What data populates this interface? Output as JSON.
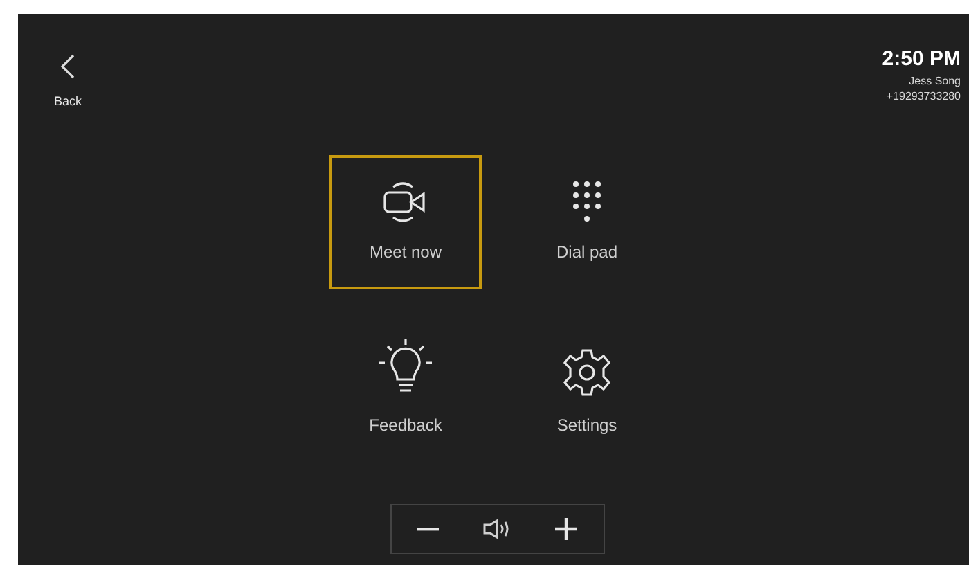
{
  "back": {
    "label": "Back"
  },
  "status": {
    "time": "2:50 PM",
    "name": "Jess Song",
    "phone": "+19293733280"
  },
  "tiles": [
    {
      "kind": "meet",
      "label": "Meet now",
      "selected": true
    },
    {
      "kind": "dialpad",
      "label": "Dial pad",
      "selected": false
    },
    {
      "kind": "feedback",
      "label": "Feedback",
      "selected": false
    },
    {
      "kind": "settings",
      "label": "Settings",
      "selected": false
    }
  ],
  "volume": {
    "kind": "volume"
  }
}
